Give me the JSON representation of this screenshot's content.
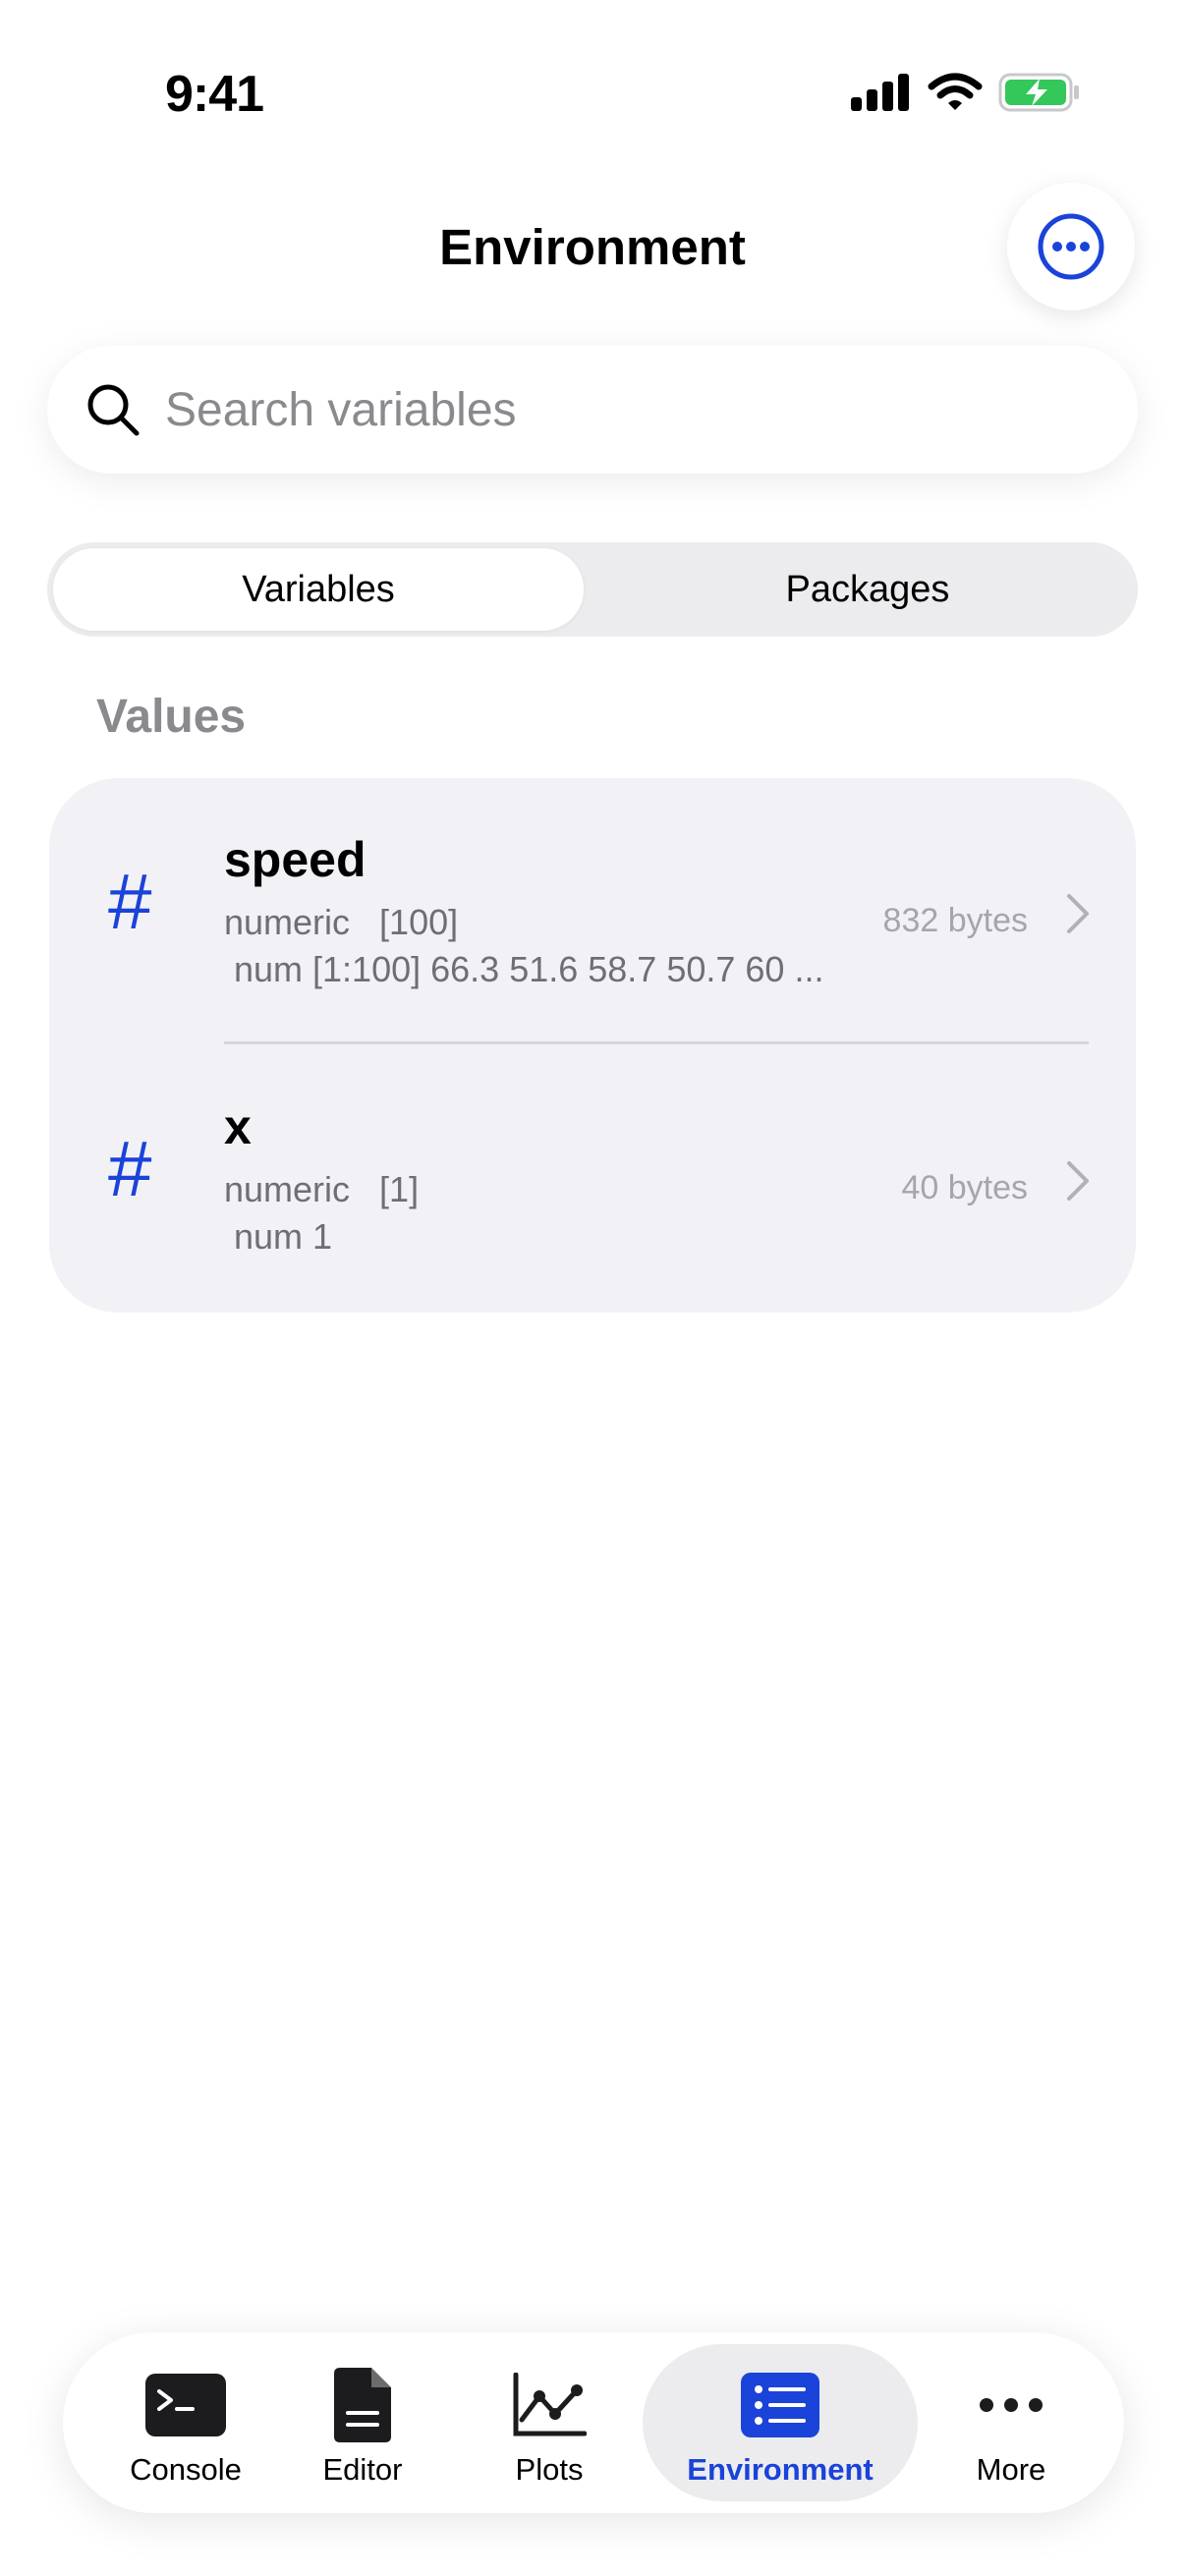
{
  "status_bar": {
    "time": "9:41"
  },
  "header": {
    "title": "Environment"
  },
  "search": {
    "placeholder": "Search variables",
    "value": ""
  },
  "segments": {
    "active": "Variables",
    "inactive": "Packages"
  },
  "section": {
    "title": "Values"
  },
  "variables": [
    {
      "icon": "#",
      "name": "speed",
      "type_line": "numeric   [100]",
      "preview": "num [1:100] 66.3 51.6 58.7 50.7 60 ...",
      "size": "832 bytes"
    },
    {
      "icon": "#",
      "name": "x",
      "type_line": "numeric   [1]",
      "preview": "num 1",
      "size": "40 bytes"
    }
  ],
  "tabbar": {
    "console": "Console",
    "editor": "Editor",
    "plots": "Plots",
    "environment": "Environment",
    "more": "More"
  },
  "colors": {
    "accent": "#1a43d9",
    "battery_green": "#34c759",
    "secondary_text": "#6e6e73",
    "card_bg": "#f2f2f6"
  }
}
